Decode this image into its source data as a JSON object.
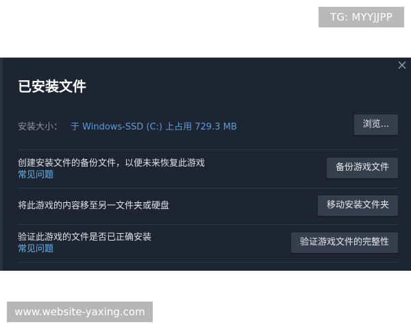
{
  "watermarks": {
    "tg": "TG: MYYJJPP",
    "site": "www.website-yaxing.com"
  },
  "dialog": {
    "title": "已安装文件",
    "close_icon": "close-icon",
    "install_size": {
      "label": "安装大小：",
      "value": "于 Windows-SSD (C:) 上占用 729.3 MB",
      "button": "浏览..."
    },
    "backup": {
      "text": "创建安装文件的备份文件，以便未来恢复此游戏",
      "link": "常见问题",
      "button": "备份游戏文件"
    },
    "move": {
      "text": "将此游戏的内容移至另一文件夹或硬盘",
      "button": "移动安装文件夹"
    },
    "verify": {
      "text": "验证此游戏的文件是否已正确安装",
      "link": "常见问题",
      "button": "验证游戏文件的完整性"
    }
  },
  "colors": {
    "dialog_bg": "#1e2532",
    "button_bg": "#353e4d",
    "link": "#67b4e8",
    "size_value": "#5e9bd6"
  }
}
